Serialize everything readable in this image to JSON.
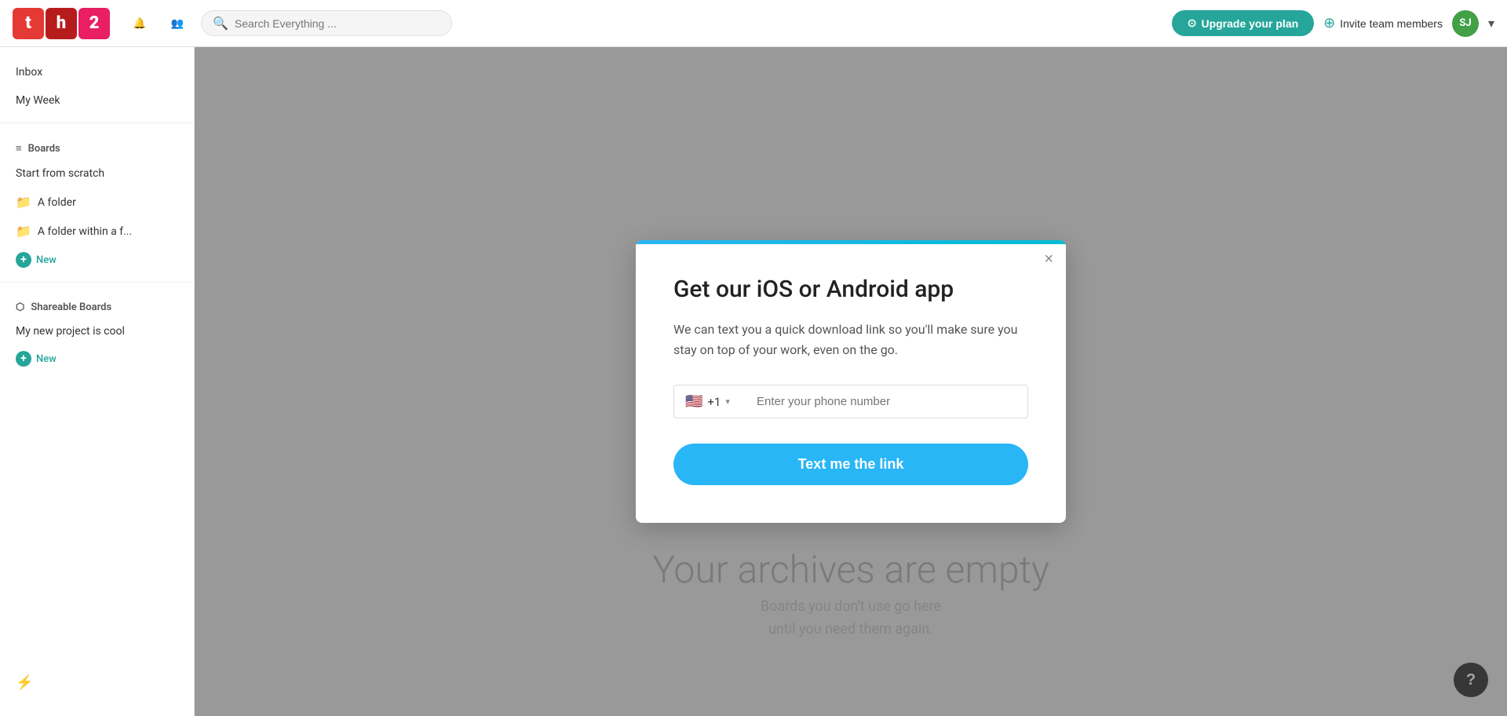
{
  "header": {
    "search_placeholder": "Search Everything ...",
    "upgrade_label": "Upgrade your plan",
    "invite_label": "Invite team members",
    "avatar_initials": "SJ"
  },
  "sidebar": {
    "inbox_label": "Inbox",
    "my_week_label": "My Week",
    "boards_label": "Boards",
    "start_scratch_label": "Start from scratch",
    "folder1_label": "A folder",
    "folder2_label": "A folder within a f...",
    "new1_label": "New",
    "shareable_boards_label": "Shareable Boards",
    "project_label": "My new project is cool",
    "new2_label": "New"
  },
  "modal": {
    "title": "Get our iOS or Android app",
    "description": "We can text you a quick download link so you'll make sure you stay on top of your work, even on the go.",
    "country_code": "+1",
    "phone_placeholder": "Enter your phone number",
    "submit_label": "Text me the link",
    "close_label": "×"
  },
  "main": {
    "archives_title": "Your archives are empty",
    "archives_sub": "Boards you don't use go here",
    "archives_sub2": "until you need them again."
  },
  "icons": {
    "bell": "🔔",
    "people": "👥",
    "search": "🔍",
    "upgrade_icon": "⊙",
    "plus": "+",
    "boards_icon": "≡",
    "share_icon": "⬡",
    "lightning": "⚡",
    "question": "?"
  }
}
